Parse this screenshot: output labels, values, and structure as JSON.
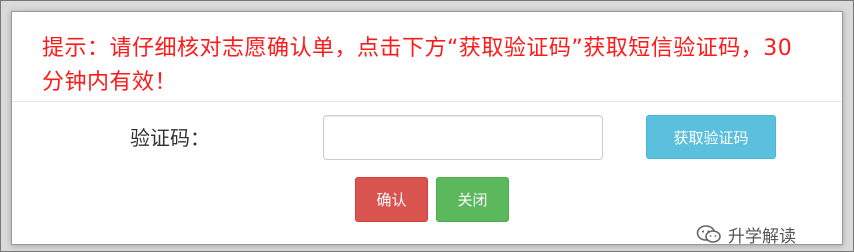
{
  "dialog": {
    "notice_text": "提示：请仔细核对志愿确认单，点击下方“获取验证码”获取短信验证码，30分钟内有效！",
    "code_label": "验证码：",
    "code_input_value": "",
    "get_code_button": "获取验证码",
    "confirm_button": "确认",
    "close_button": "关闭"
  },
  "watermark": {
    "icon": "wechat-icon",
    "text": "升学解读"
  },
  "colors": {
    "notice": "#ff1a1a",
    "get_code_button": "#5bc0de",
    "confirm_button": "#d9534f",
    "close_button": "#5cb85c"
  }
}
